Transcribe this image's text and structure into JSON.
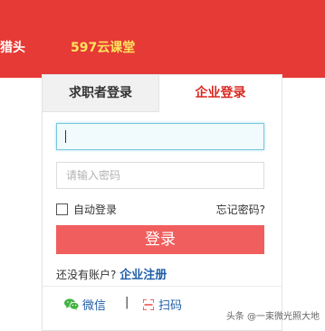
{
  "header": {
    "nav_left": "猎头",
    "nav_right": "597云课堂"
  },
  "login": {
    "tabs": [
      {
        "label": "求职者登录",
        "active": false
      },
      {
        "label": "企业登录",
        "active": true
      }
    ],
    "username_value": "",
    "password_placeholder": "请输入密码",
    "remember_label": "自动登录",
    "remember_checked": false,
    "forgot_label": "忘记密码?",
    "submit_label": "登录",
    "register_prompt": "还没有账户?",
    "register_link": "企业注册",
    "social": {
      "wechat_label": "微信",
      "separator": "|",
      "qr_label": "扫码"
    }
  },
  "watermark": "头条 @一束微光照大地",
  "colors": {
    "header_bg": "#e63a36",
    "header_highlight": "#ffe45c",
    "active_tab": "#d8271f",
    "button_bg": "#f15e5e",
    "link": "#1f5ea8",
    "wechat_green": "#3fb23f"
  },
  "icons": {
    "wechat": "wechat-icon",
    "qr": "qr-scan-icon"
  }
}
